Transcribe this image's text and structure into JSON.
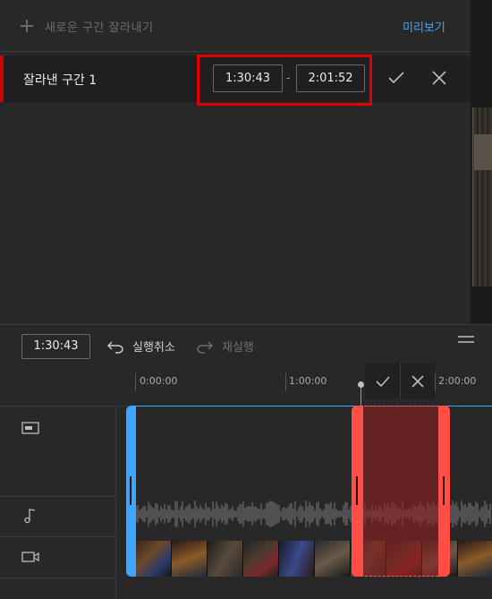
{
  "header": {
    "add_segment_label": "새로운 구간 잘라내기",
    "preview_label": "미리보기"
  },
  "segment": {
    "label": "잘라낸 구간 1",
    "start": "1:30:43",
    "separator": "-",
    "end": "2:01:52"
  },
  "toolbar": {
    "current_time": "1:30:43",
    "undo_label": "실행취소",
    "redo_label": "재실행"
  },
  "ruler": {
    "ticks": [
      "0:00:00",
      "1:00:00",
      "2:00:00"
    ]
  },
  "tracks": {
    "icons": [
      "subtitle-icon",
      "music-note-icon",
      "video-camera-icon"
    ]
  },
  "colors": {
    "accent_blue": "#3ea6ff",
    "trim_red": "#ff4e45",
    "highlight_red": "#e00000",
    "background": "#282828"
  }
}
